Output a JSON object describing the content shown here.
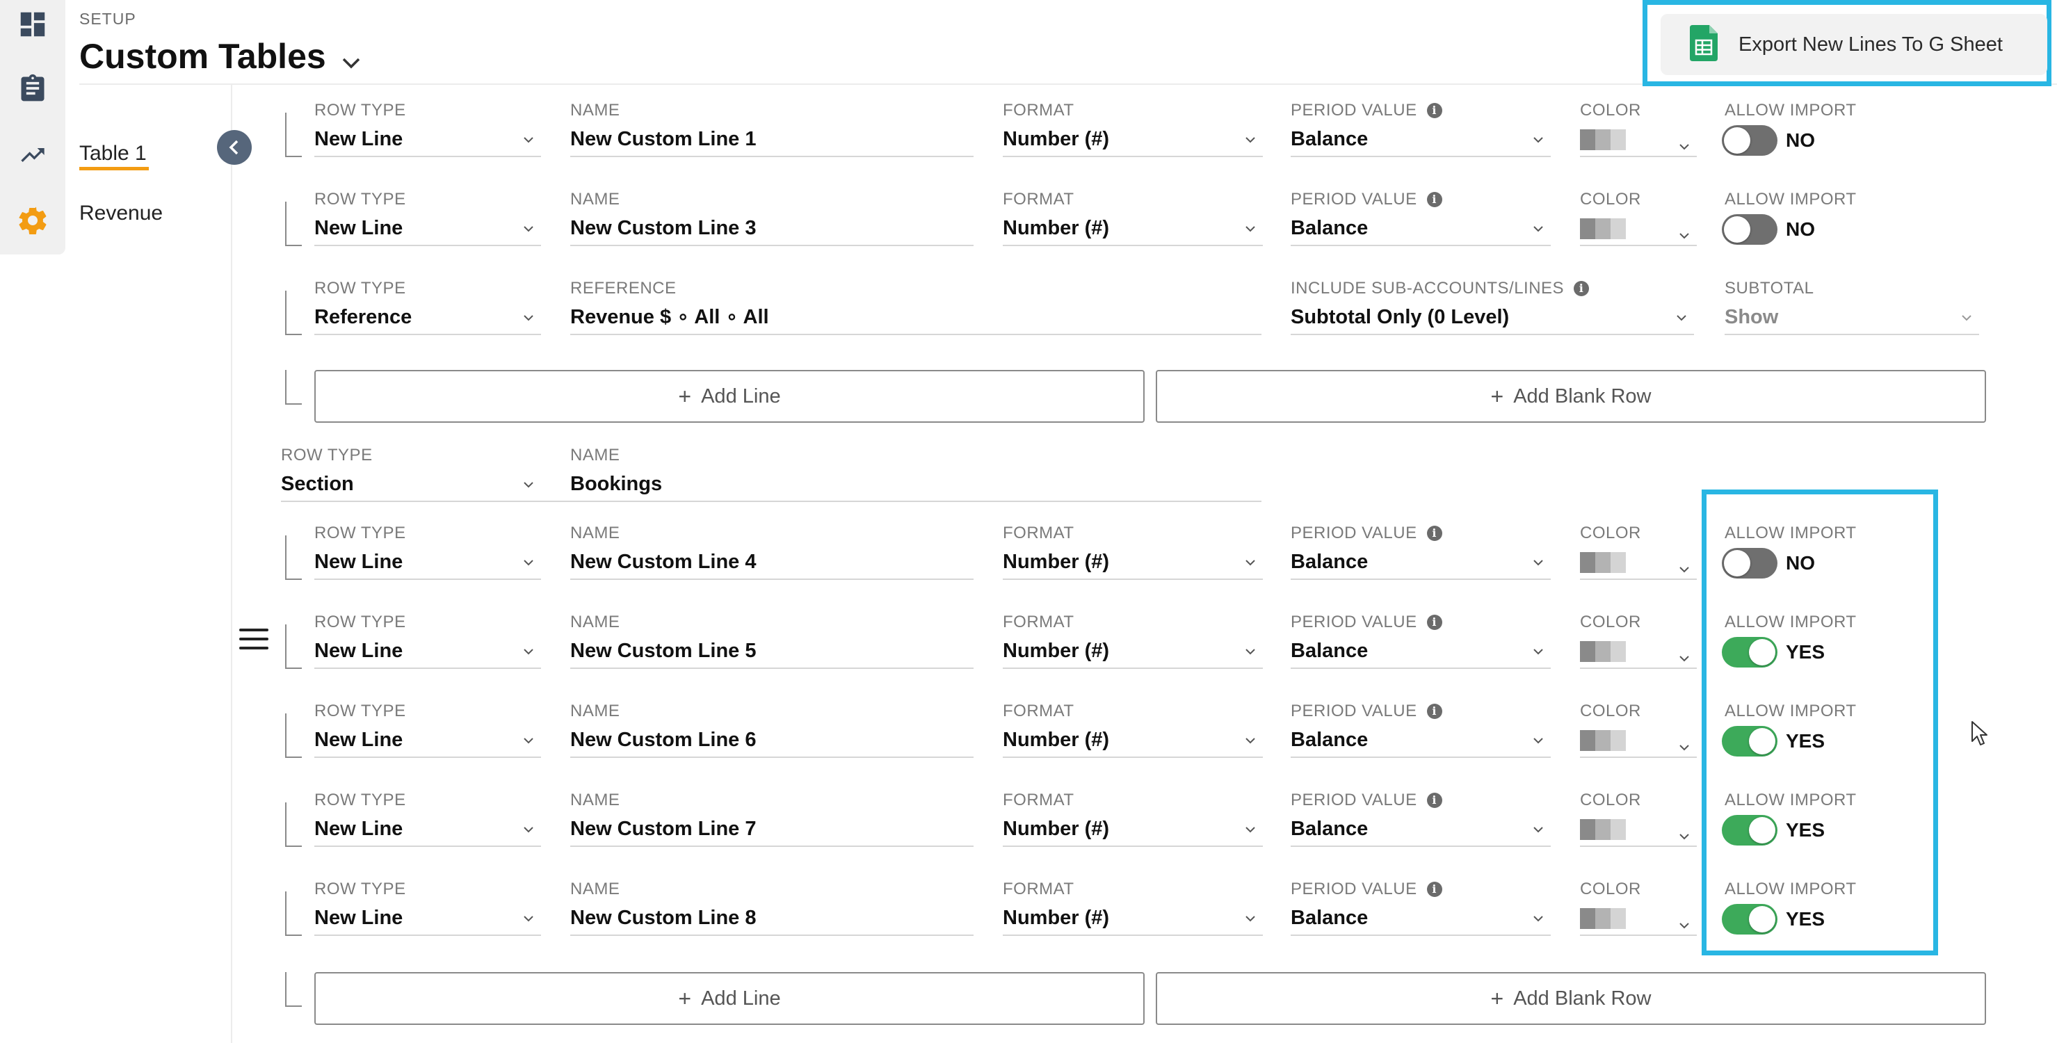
{
  "header": {
    "section": "SETUP",
    "title": "Custom Tables",
    "export_label": "Export New Lines To G Sheet"
  },
  "subnav": {
    "items": [
      {
        "label": "Table 1"
      },
      {
        "label": "Revenue"
      }
    ]
  },
  "labels": {
    "row_type": "ROW TYPE",
    "name": "NAME",
    "format": "FORMAT",
    "period_value": "PERIOD VALUE",
    "color": "COLOR",
    "allow_import": "ALLOW IMPORT",
    "reference": "REFERENCE",
    "include_sub": "INCLUDE SUB-ACCOUNTS/LINES",
    "subtotal": "SUBTOTAL"
  },
  "rows": [
    {
      "row_type": "New Line",
      "name": "New Custom Line 1",
      "format": "Number (#)",
      "period_value": "Balance",
      "allow_import": "NO"
    },
    {
      "row_type": "New Line",
      "name": "New Custom Line 3",
      "format": "Number (#)",
      "period_value": "Balance",
      "allow_import": "NO"
    },
    {
      "row_type": "Reference",
      "reference": "Revenue $ ∘ All ∘ All",
      "include_sub": "Subtotal Only (0 Level)",
      "subtotal": "Show"
    },
    {
      "row_type": "Section",
      "name": "Bookings"
    },
    {
      "row_type": "New Line",
      "name": "New Custom Line 4",
      "format": "Number (#)",
      "period_value": "Balance",
      "allow_import": "NO"
    },
    {
      "row_type": "New Line",
      "name": "New Custom Line 5",
      "format": "Number (#)",
      "period_value": "Balance",
      "allow_import": "YES"
    },
    {
      "row_type": "New Line",
      "name": "New Custom Line 6",
      "format": "Number (#)",
      "period_value": "Balance",
      "allow_import": "YES"
    },
    {
      "row_type": "New Line",
      "name": "New Custom Line 7",
      "format": "Number (#)",
      "period_value": "Balance",
      "allow_import": "YES"
    },
    {
      "row_type": "New Line",
      "name": "New Custom Line 8",
      "format": "Number (#)",
      "period_value": "Balance",
      "allow_import": "YES"
    }
  ],
  "buttons": {
    "add_line": "Add Line",
    "add_blank_row": "Add Blank Row"
  },
  "colors": {
    "accent_highlight": "#29b6e3",
    "toggle_on": "#3daa5a",
    "toggle_off": "#6f6f6f",
    "active_tab_underline": "#f39c12",
    "settings_icon": "#f39c12"
  },
  "icons": [
    "dashboard-icon",
    "clipboard-icon",
    "trend-icon",
    "gear-icon",
    "chevron-down-icon",
    "sheets-icon",
    "chevron-left-icon",
    "drag-handle-icon",
    "info-icon",
    "plus-icon",
    "cursor-icon"
  ]
}
